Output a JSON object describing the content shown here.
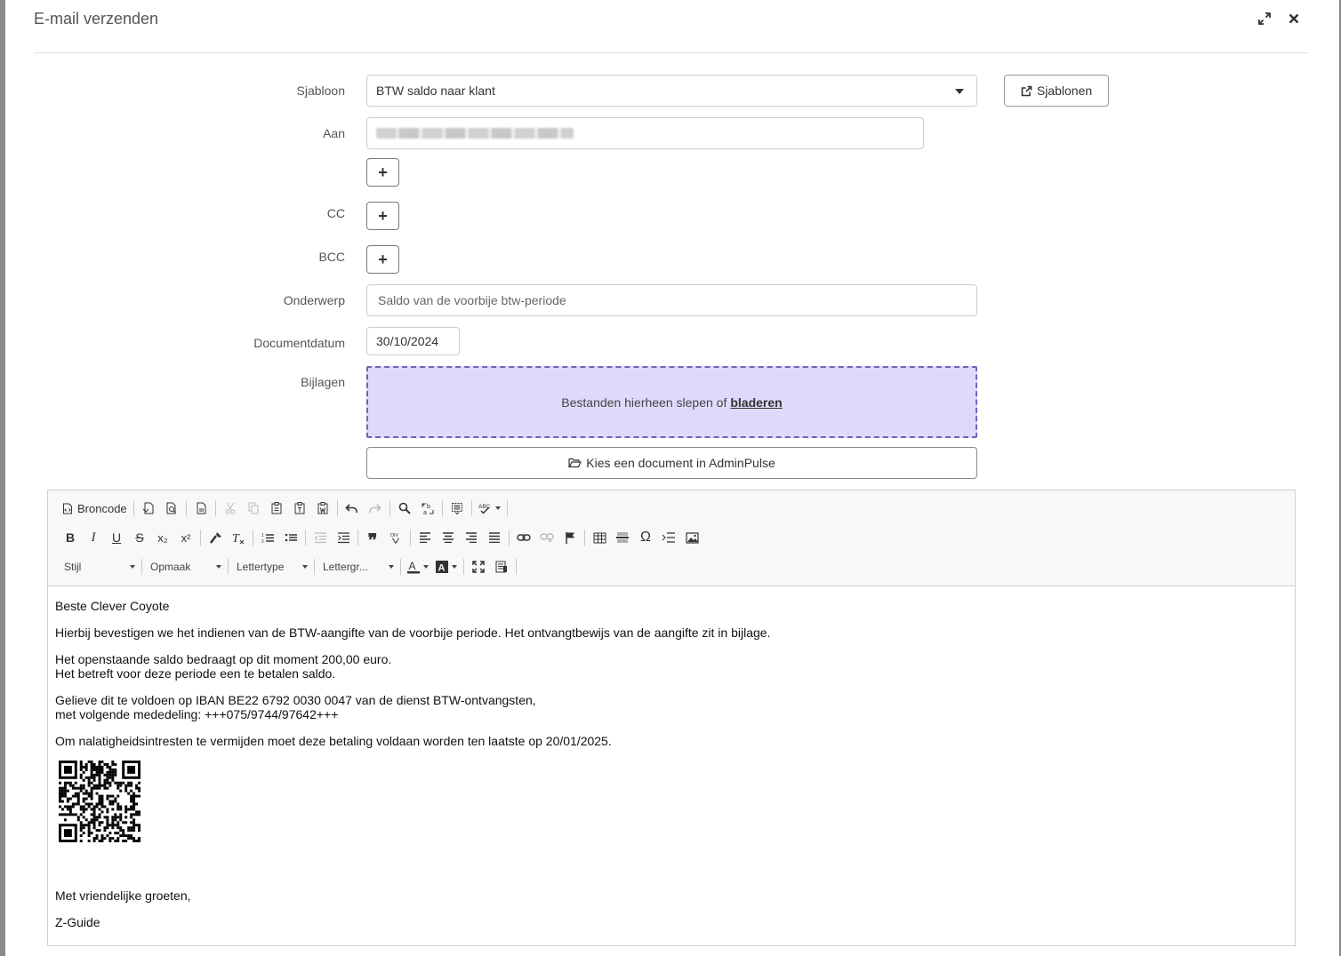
{
  "dialog": {
    "title": "E-mail verzenden",
    "icons": {
      "expand": "expand-icon",
      "close": "close-icon"
    }
  },
  "form": {
    "template_label": "Sjabloon",
    "template_value": "BTW saldo naar klant",
    "templates_button": "Sjablonen",
    "to_label": "Aan",
    "cc_label": "CC",
    "bcc_label": "BCC",
    "add_symbol": "+",
    "subject_label": "Onderwerp",
    "subject_placeholder": "Saldo van de voorbije btw-periode",
    "date_label": "Documentdatum",
    "date_value": "30/10/2024",
    "attachments_label": "Bijlagen",
    "dropzone_text": "Bestanden hierheen slepen of",
    "dropzone_link": "bladeren",
    "choose_doc_button": "Kies een document in AdminPulse"
  },
  "editor": {
    "source_label": "Broncode",
    "combos": {
      "style": "Stijl",
      "format": "Opmaak",
      "font": "Lettertype",
      "size": "Lettergr..."
    },
    "glyphs": {
      "bold": "B",
      "italic": "I",
      "underline": "U",
      "strike": "S",
      "sub": "x₂",
      "sup": "x²",
      "quote": "❞",
      "omega": "Ω"
    },
    "body": {
      "greeting": "Beste Clever Coyote",
      "p1": "Hierbij bevestigen we het indienen van de BTW-aangifte van de voorbije periode. Het ontvangtbewijs van de aangifte zit in bijlage.",
      "p2a": "Het openstaande saldo bedraagt op dit moment 200,00 euro.",
      "p2b": "Het betreft voor deze periode een te betalen saldo.",
      "p3a": "Gelieve dit te voldoen op IBAN BE22 6792 0030 0047 van de dienst BTW-ontvangsten,",
      "p3b": "met volgende mededeling: +++075/9744/97642+++",
      "p4": "Om nalatigheidsintresten te vermijden moet deze betaling voldaan worden ten laatste op 20/01/2025.",
      "closing": "Met vriendelijke groeten,",
      "signature": "Z-Guide"
    }
  }
}
